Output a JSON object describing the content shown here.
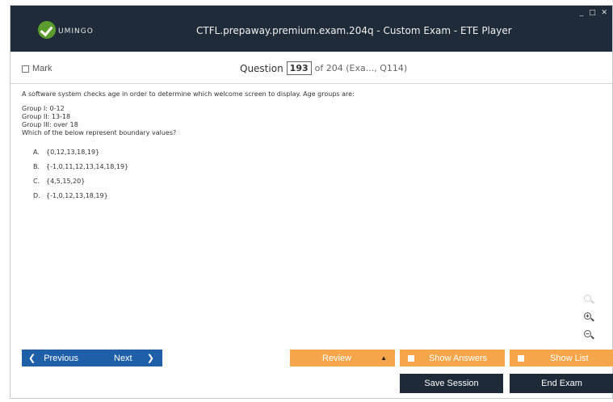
{
  "app": {
    "logo_text": "UMINGO",
    "title": "CTFL.prepaway.premium.exam.204q - Custom Exam - ETE Player",
    "window_controls": "_ □ ✕"
  },
  "question_bar": {
    "mark_label": "Mark",
    "question_label": "Question",
    "question_number": "193",
    "of_text": "of 204 (Exa..., Q114)"
  },
  "question": {
    "stem": "A software system checks age in order to determine which welcome screen to display. Age groups are:",
    "groups": [
      "Group I: 0-12",
      "Group II: 13-18",
      "Group III: over 18"
    ],
    "prompt": "Which of the below represent boundary values?",
    "options": [
      {
        "letter": "A.",
        "text": "{0,12,13,18,19}"
      },
      {
        "letter": "B.",
        "text": "{-1,0,11,12,13,14,18,19}"
      },
      {
        "letter": "C.",
        "text": "{4,5,15,20}"
      },
      {
        "letter": "D.",
        "text": "{-1,0,12,13,18,19}"
      }
    ]
  },
  "toolbar": {
    "previous_label": "Previous",
    "next_label": "Next",
    "review_label": "Review",
    "show_answers_label": "Show Answers",
    "show_list_label": "Show List",
    "save_session_label": "Save Session",
    "end_exam_label": "End Exam",
    "prev_arrow": "❮",
    "next_arrow": "❯",
    "review_caret": "▲"
  },
  "zoom": {
    "zoom_in_sign": "+",
    "zoom_out_sign": "−"
  },
  "colors": {
    "titlebar": "#202b3a",
    "nav_blue": "#1f5fa8",
    "orange": "#f5a64b",
    "dark_button": "#1e2a38",
    "logo_green": "#5c9c2e"
  }
}
